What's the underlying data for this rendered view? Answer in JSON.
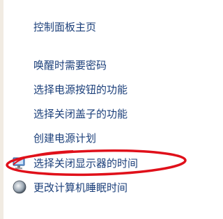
{
  "sidebar": {
    "home_label": "控制面板主页",
    "items": [
      {
        "label": "唤醒时需要密码"
      },
      {
        "label": "选择电源按钮的功能"
      },
      {
        "label": "选择关闭盖子的功能"
      },
      {
        "label": "创建电源计划"
      },
      {
        "label": "选择关闭显示器的时间",
        "icon": "display-shield-icon",
        "highlighted": true
      },
      {
        "label": "更改计算机睡眠时间",
        "icon": "moon-sleep-icon"
      }
    ]
  },
  "colors": {
    "link": "#1b3f7a",
    "highlight_ellipse": "#e0101a",
    "background": "#ffffff",
    "left_edge": "#f1ebe2"
  }
}
